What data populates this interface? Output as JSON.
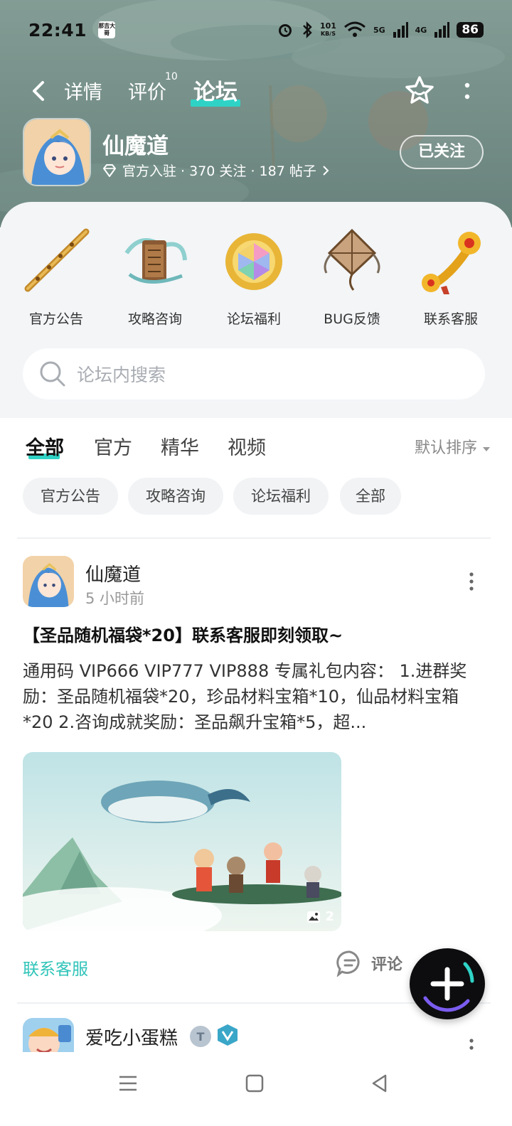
{
  "status_bar": {
    "time": "22:41",
    "carrier_badge": "那吉大哥",
    "net_speed_value": "101",
    "net_speed_unit": "KB/S",
    "net1": "5G",
    "net2": "4G",
    "battery": "86"
  },
  "header": {
    "tabs": [
      {
        "label": "详情"
      },
      {
        "label": "评价",
        "badge": "10"
      },
      {
        "label": "论坛"
      }
    ],
    "active_tab": "论坛"
  },
  "app": {
    "name": "仙魔道",
    "meta": "官方入驻 · 370 关注 · 187 帖子",
    "follow_label": "已关注"
  },
  "quick_entries": [
    {
      "label": "官方公告",
      "icon": "flute-icon"
    },
    {
      "label": "攻略咨询",
      "icon": "scroll-icon"
    },
    {
      "label": "论坛福利",
      "icon": "gem-icon"
    },
    {
      "label": "BUG反馈",
      "icon": "kite-icon"
    },
    {
      "label": "联系客服",
      "icon": "ruyi-icon"
    }
  ],
  "search": {
    "placeholder": "论坛内搜索"
  },
  "filter_tabs": [
    {
      "label": "全部"
    },
    {
      "label": "官方"
    },
    {
      "label": "精华"
    },
    {
      "label": "视频"
    }
  ],
  "sort_label": "默认排序",
  "chips": [
    {
      "label": "官方公告"
    },
    {
      "label": "攻略咨询"
    },
    {
      "label": "论坛福利"
    },
    {
      "label": "全部"
    }
  ],
  "posts": [
    {
      "author": "仙魔道",
      "time": "5 小时前",
      "title": "【圣品随机福袋*20】联系客服即刻领取~",
      "body": "通用码 VIP666 VIP777 VIP888 专属礼包内容： 1.进群奖励：圣品随机福袋*20，珍品材料宝箱*10，仙品材料宝箱*20 2.咨询成就奖励：圣品飙升宝箱*5，超...",
      "image_count": "2",
      "tag": "联系客服",
      "comment_label": "评论"
    },
    {
      "author": "爱吃小蛋糕"
    }
  ],
  "colors": {
    "accent": "#2fd3c6",
    "tag": "#2fc4b9"
  }
}
